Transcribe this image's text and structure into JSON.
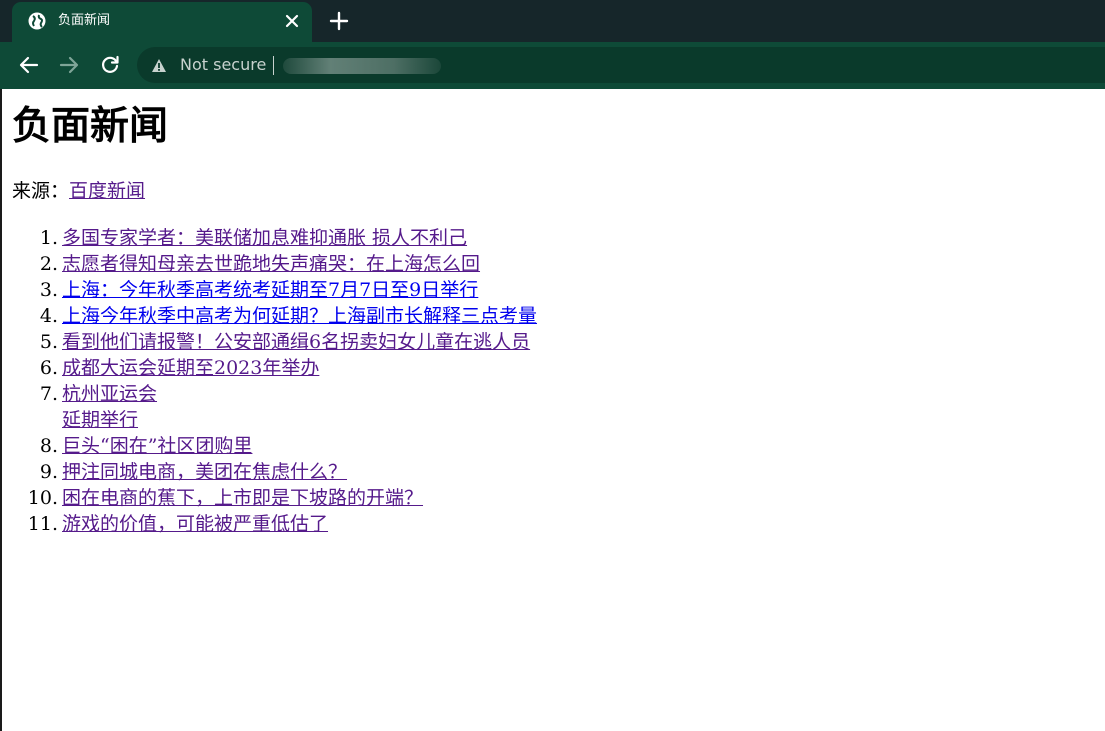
{
  "browser": {
    "tab_title": "负面新闻",
    "security_label": "Not secure",
    "colors": {
      "tabstrip": "#16262a",
      "toolbar": "#0e4a37",
      "omnibox": "#0a3a2b"
    }
  },
  "page": {
    "title": "负面新闻",
    "source_prefix": "来源：",
    "source_link": "百度新闻",
    "news": [
      {
        "num": "1.",
        "lines": [
          "多国专家学者：美联储加息难抑通胀 损人不利己"
        ],
        "visited": true
      },
      {
        "num": "2.",
        "lines": [
          "志愿者得知母亲去世跪地失声痛哭：在上海怎么回"
        ],
        "visited": true
      },
      {
        "num": "3.",
        "lines": [
          "上海：今年秋季高考统考延期至7月7日至9日举行"
        ],
        "visited": false
      },
      {
        "num": "4.",
        "lines": [
          "上海今年秋季中高考为何延期？上海副市长解释三点考量"
        ],
        "visited": false
      },
      {
        "num": "5.",
        "lines": [
          "看到他们请报警！公安部通缉6名拐卖妇女儿童在逃人员"
        ],
        "visited": true
      },
      {
        "num": "6.",
        "lines": [
          "成都大运会延期至2023年举办"
        ],
        "visited": true
      },
      {
        "num": "7.",
        "lines": [
          "杭州亚运会",
          "延期举行"
        ],
        "visited": true
      },
      {
        "num": "8.",
        "lines": [
          "巨头“困在”社区团购里"
        ],
        "visited": true
      },
      {
        "num": "9.",
        "lines": [
          "押注同城电商，美团在焦虑什么？"
        ],
        "visited": true
      },
      {
        "num": "10.",
        "lines": [
          "困在电商的蕉下，上市即是下坡路的开端？"
        ],
        "visited": true
      },
      {
        "num": "11.",
        "lines": [
          "游戏的价值，可能被严重低估了"
        ],
        "visited": true
      }
    ],
    "link_colors": {
      "visited": "#551a8b",
      "unvisited": "#0000ee"
    }
  }
}
